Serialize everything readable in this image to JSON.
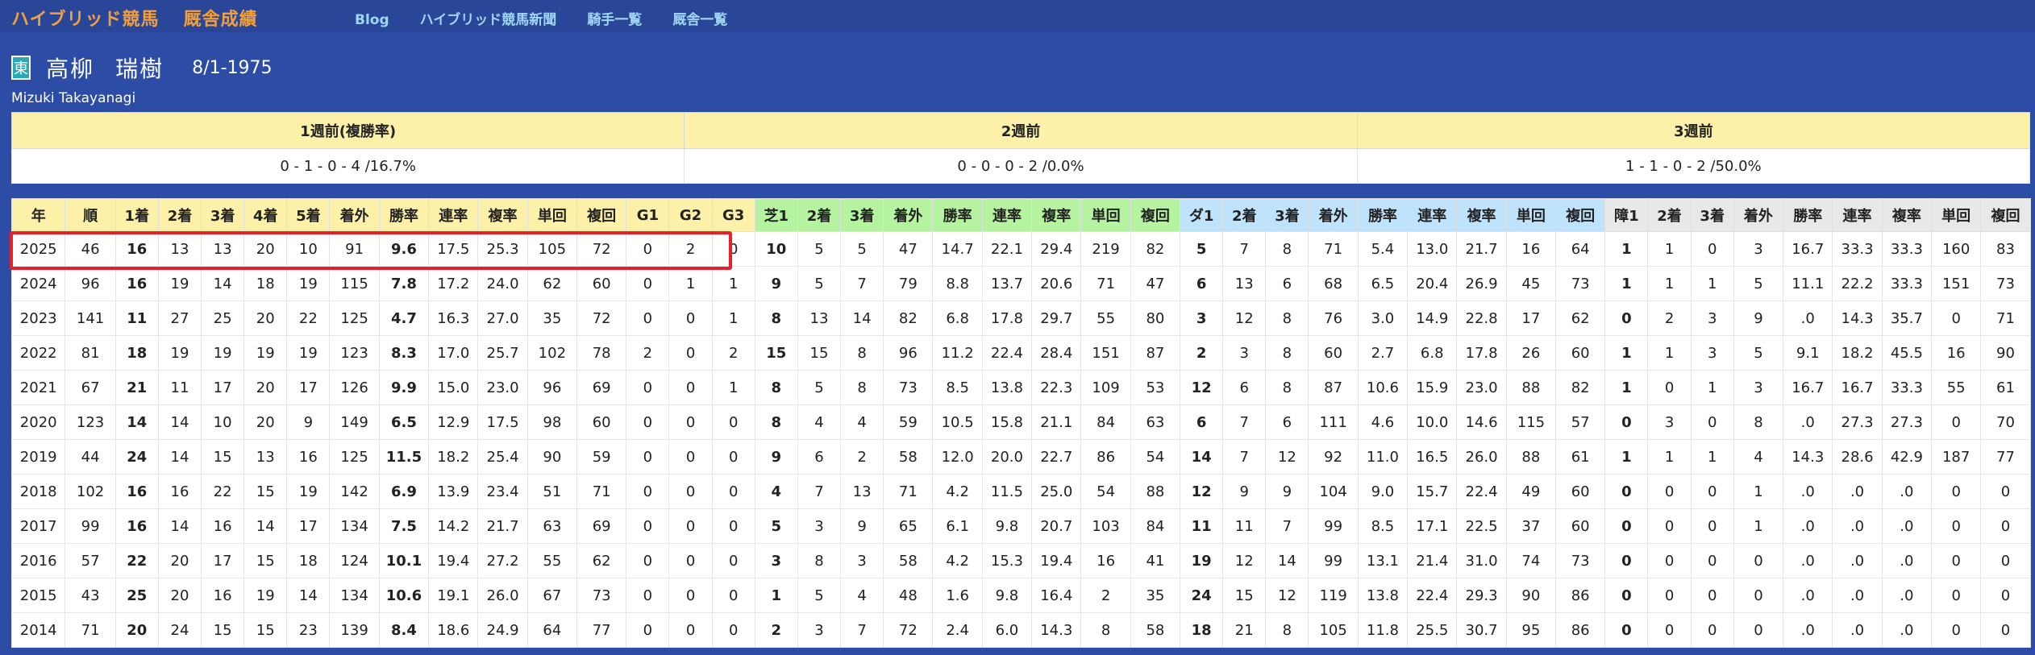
{
  "brand": {
    "title": "ハイブリッド競馬",
    "subtitle": "厩舎成績"
  },
  "nav": [
    {
      "label": "Blog"
    },
    {
      "label": "ハイブリッド競馬新聞"
    },
    {
      "label": "騎手一覧"
    },
    {
      "label": "厩舎一覧"
    }
  ],
  "jockey": {
    "badge": "東",
    "family_name": "高柳",
    "given_name": "瑞樹",
    "dob": "8/1-1975",
    "name_en": "Mizuki Takayanagi"
  },
  "weeks": [
    {
      "header": "1週前(複勝率)",
      "value": "0 - 1 - 0 - 4 /16.7%"
    },
    {
      "header": "2週前",
      "value": "0 - 0 - 0 - 2 /0.0%"
    },
    {
      "header": "3週前",
      "value": "1 - 1 - 0 - 2 /50.0%"
    }
  ],
  "colors": {
    "highlight": "#e8202a",
    "header_general": "#fdf0a8",
    "header_turf": "#b5f3a0",
    "header_dirt": "#bfe3fb",
    "header_hurdle": "#e8e8e8"
  },
  "table": {
    "headers": [
      "年",
      "順",
      "1着",
      "2着",
      "3着",
      "4着",
      "5着",
      "着外",
      "勝率",
      "連率",
      "複率",
      "単回",
      "複回",
      "G1",
      "G2",
      "G3",
      "芝1",
      "2着",
      "3着",
      "着外",
      "勝率",
      "連率",
      "複率",
      "単回",
      "複回",
      "ダ1",
      "2着",
      "3着",
      "着外",
      "勝率",
      "連率",
      "複率",
      "単回",
      "複回",
      "障1",
      "2着",
      "3着",
      "着外",
      "勝率",
      "連率",
      "複率",
      "単回",
      "複回"
    ],
    "rows": [
      [
        "2025",
        "46",
        "16",
        "13",
        "13",
        "20",
        "10",
        "91",
        "9.6",
        "17.5",
        "25.3",
        "105",
        "72",
        "0",
        "2",
        "0",
        "10",
        "5",
        "5",
        "47",
        "14.7",
        "22.1",
        "29.4",
        "219",
        "82",
        "5",
        "7",
        "8",
        "71",
        "5.4",
        "13.0",
        "21.7",
        "16",
        "64",
        "1",
        "1",
        "0",
        "3",
        "16.7",
        "33.3",
        "33.3",
        "160",
        "83"
      ],
      [
        "2024",
        "96",
        "16",
        "19",
        "14",
        "18",
        "19",
        "115",
        "7.8",
        "17.2",
        "24.0",
        "62",
        "60",
        "0",
        "1",
        "1",
        "9",
        "5",
        "7",
        "79",
        "8.8",
        "13.7",
        "20.6",
        "71",
        "47",
        "6",
        "13",
        "6",
        "68",
        "6.5",
        "20.4",
        "26.9",
        "45",
        "73",
        "1",
        "1",
        "1",
        "5",
        "11.1",
        "22.2",
        "33.3",
        "151",
        "73"
      ],
      [
        "2023",
        "141",
        "11",
        "27",
        "25",
        "20",
        "22",
        "125",
        "4.7",
        "16.3",
        "27.0",
        "35",
        "72",
        "0",
        "0",
        "1",
        "8",
        "13",
        "14",
        "82",
        "6.8",
        "17.8",
        "29.7",
        "55",
        "80",
        "3",
        "12",
        "8",
        "76",
        "3.0",
        "14.9",
        "22.8",
        "17",
        "62",
        "0",
        "2",
        "3",
        "9",
        ".0",
        "14.3",
        "35.7",
        "0",
        "71"
      ],
      [
        "2022",
        "81",
        "18",
        "19",
        "19",
        "19",
        "19",
        "123",
        "8.3",
        "17.0",
        "25.7",
        "102",
        "78",
        "2",
        "0",
        "2",
        "15",
        "15",
        "8",
        "96",
        "11.2",
        "22.4",
        "28.4",
        "151",
        "87",
        "2",
        "3",
        "8",
        "60",
        "2.7",
        "6.8",
        "17.8",
        "26",
        "60",
        "1",
        "1",
        "3",
        "5",
        "9.1",
        "18.2",
        "45.5",
        "16",
        "90"
      ],
      [
        "2021",
        "67",
        "21",
        "11",
        "17",
        "20",
        "17",
        "126",
        "9.9",
        "15.0",
        "23.0",
        "96",
        "69",
        "0",
        "0",
        "1",
        "8",
        "5",
        "8",
        "73",
        "8.5",
        "13.8",
        "22.3",
        "109",
        "53",
        "12",
        "6",
        "8",
        "87",
        "10.6",
        "15.9",
        "23.0",
        "88",
        "82",
        "1",
        "0",
        "1",
        "3",
        "16.7",
        "16.7",
        "33.3",
        "55",
        "61"
      ],
      [
        "2020",
        "123",
        "14",
        "14",
        "10",
        "20",
        "9",
        "149",
        "6.5",
        "12.9",
        "17.5",
        "98",
        "60",
        "0",
        "0",
        "0",
        "8",
        "4",
        "4",
        "59",
        "10.5",
        "15.8",
        "21.1",
        "84",
        "63",
        "6",
        "7",
        "6",
        "111",
        "4.6",
        "10.0",
        "14.6",
        "115",
        "57",
        "0",
        "3",
        "0",
        "8",
        ".0",
        "27.3",
        "27.3",
        "0",
        "70"
      ],
      [
        "2019",
        "44",
        "24",
        "14",
        "15",
        "13",
        "16",
        "125",
        "11.5",
        "18.2",
        "25.4",
        "90",
        "59",
        "0",
        "0",
        "0",
        "9",
        "6",
        "2",
        "58",
        "12.0",
        "20.0",
        "22.7",
        "86",
        "54",
        "14",
        "7",
        "12",
        "92",
        "11.0",
        "16.5",
        "26.0",
        "88",
        "61",
        "1",
        "1",
        "1",
        "4",
        "14.3",
        "28.6",
        "42.9",
        "187",
        "77"
      ],
      [
        "2018",
        "102",
        "16",
        "16",
        "22",
        "15",
        "19",
        "142",
        "6.9",
        "13.9",
        "23.4",
        "51",
        "71",
        "0",
        "0",
        "0",
        "4",
        "7",
        "13",
        "71",
        "4.2",
        "11.5",
        "25.0",
        "54",
        "88",
        "12",
        "9",
        "9",
        "104",
        "9.0",
        "15.7",
        "22.4",
        "49",
        "60",
        "0",
        "0",
        "0",
        "1",
        ".0",
        ".0",
        ".0",
        "0",
        "0"
      ],
      [
        "2017",
        "99",
        "16",
        "14",
        "16",
        "14",
        "17",
        "134",
        "7.5",
        "14.2",
        "21.7",
        "63",
        "69",
        "0",
        "0",
        "0",
        "5",
        "3",
        "9",
        "65",
        "6.1",
        "9.8",
        "20.7",
        "103",
        "84",
        "11",
        "11",
        "7",
        "99",
        "8.5",
        "17.1",
        "22.5",
        "37",
        "60",
        "0",
        "0",
        "0",
        "1",
        ".0",
        ".0",
        ".0",
        "0",
        "0"
      ],
      [
        "2016",
        "57",
        "22",
        "20",
        "17",
        "15",
        "18",
        "124",
        "10.1",
        "19.4",
        "27.2",
        "55",
        "62",
        "0",
        "0",
        "0",
        "3",
        "8",
        "3",
        "58",
        "4.2",
        "15.3",
        "19.4",
        "16",
        "41",
        "19",
        "12",
        "14",
        "99",
        "13.1",
        "21.4",
        "31.0",
        "74",
        "73",
        "0",
        "0",
        "0",
        "0",
        ".0",
        ".0",
        ".0",
        "0",
        "0"
      ],
      [
        "2015",
        "43",
        "25",
        "20",
        "16",
        "19",
        "14",
        "134",
        "10.6",
        "19.1",
        "26.0",
        "67",
        "73",
        "0",
        "0",
        "0",
        "1",
        "5",
        "4",
        "48",
        "1.6",
        "9.8",
        "16.4",
        "2",
        "35",
        "24",
        "15",
        "12",
        "119",
        "13.8",
        "22.4",
        "29.3",
        "90",
        "86",
        "0",
        "0",
        "0",
        "0",
        ".0",
        ".0",
        ".0",
        "0",
        "0"
      ],
      [
        "2014",
        "71",
        "20",
        "24",
        "15",
        "15",
        "23",
        "139",
        "8.4",
        "18.6",
        "24.9",
        "64",
        "77",
        "0",
        "0",
        "0",
        "2",
        "3",
        "7",
        "72",
        "2.4",
        "6.0",
        "14.3",
        "8",
        "58",
        "18",
        "21",
        "8",
        "105",
        "11.8",
        "25.5",
        "30.7",
        "95",
        "86",
        "0",
        "0",
        "0",
        "0",
        ".0",
        ".0",
        ".0",
        "0",
        "0"
      ]
    ]
  }
}
